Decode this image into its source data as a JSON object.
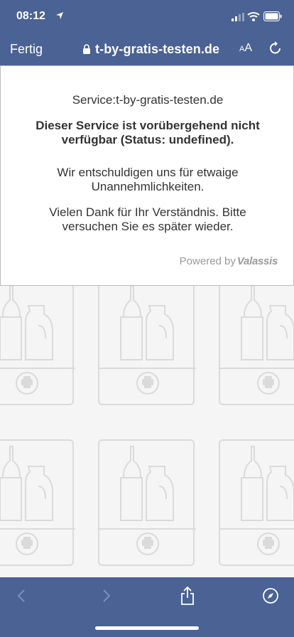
{
  "status_bar": {
    "time": "08:12"
  },
  "nav": {
    "done_label": "Fertig",
    "url": "t-by-gratis-testen.de",
    "text_size_small": "A",
    "text_size_large": "A"
  },
  "page": {
    "service_line": "Service:t-by-gratis-testen.de",
    "error_message": "Dieser Service ist vorübergehend nicht verfügbar (Status: undefined).",
    "apology": "Wir entschuldigen uns für etwaige Unannehmlichkeiten.",
    "thanks": "Vielen Dank für Ihr Verständnis. Bitte versuchen Sie es später wieder.",
    "powered_by": "Powered by",
    "brand": "Valassis"
  },
  "colors": {
    "chrome": "#4a6294",
    "tile_line": "#dadada"
  }
}
